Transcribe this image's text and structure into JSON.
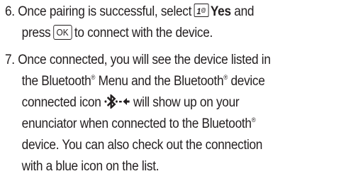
{
  "step6": {
    "number": "6.",
    "line1_text": "Once pairing is successful, select",
    "key_badge_main": "1",
    "key_badge_sub": "@",
    "yes_label": "Yes",
    "line1_tail": "and",
    "line2_pre": "press",
    "ok_key": "OK",
    "line2_post": "to connect with the device."
  },
  "step7": {
    "number": "7.",
    "line1": "Once connected, you will see the device listed in",
    "line2_pre": "the Bluetooth",
    "line2_mid": "Menu and the Bluetooth",
    "line2_post": "device",
    "line3_pre": "connected icon",
    "line3_post": "will show up on your",
    "line4_pre": "enunciator when connected to the Bluetooth",
    "line5": "device. You can also check out the connection",
    "line6": "with a blue icon on the list.",
    "registered_mark": "®",
    "connected_icon": "bluetooth-connected-icon"
  }
}
